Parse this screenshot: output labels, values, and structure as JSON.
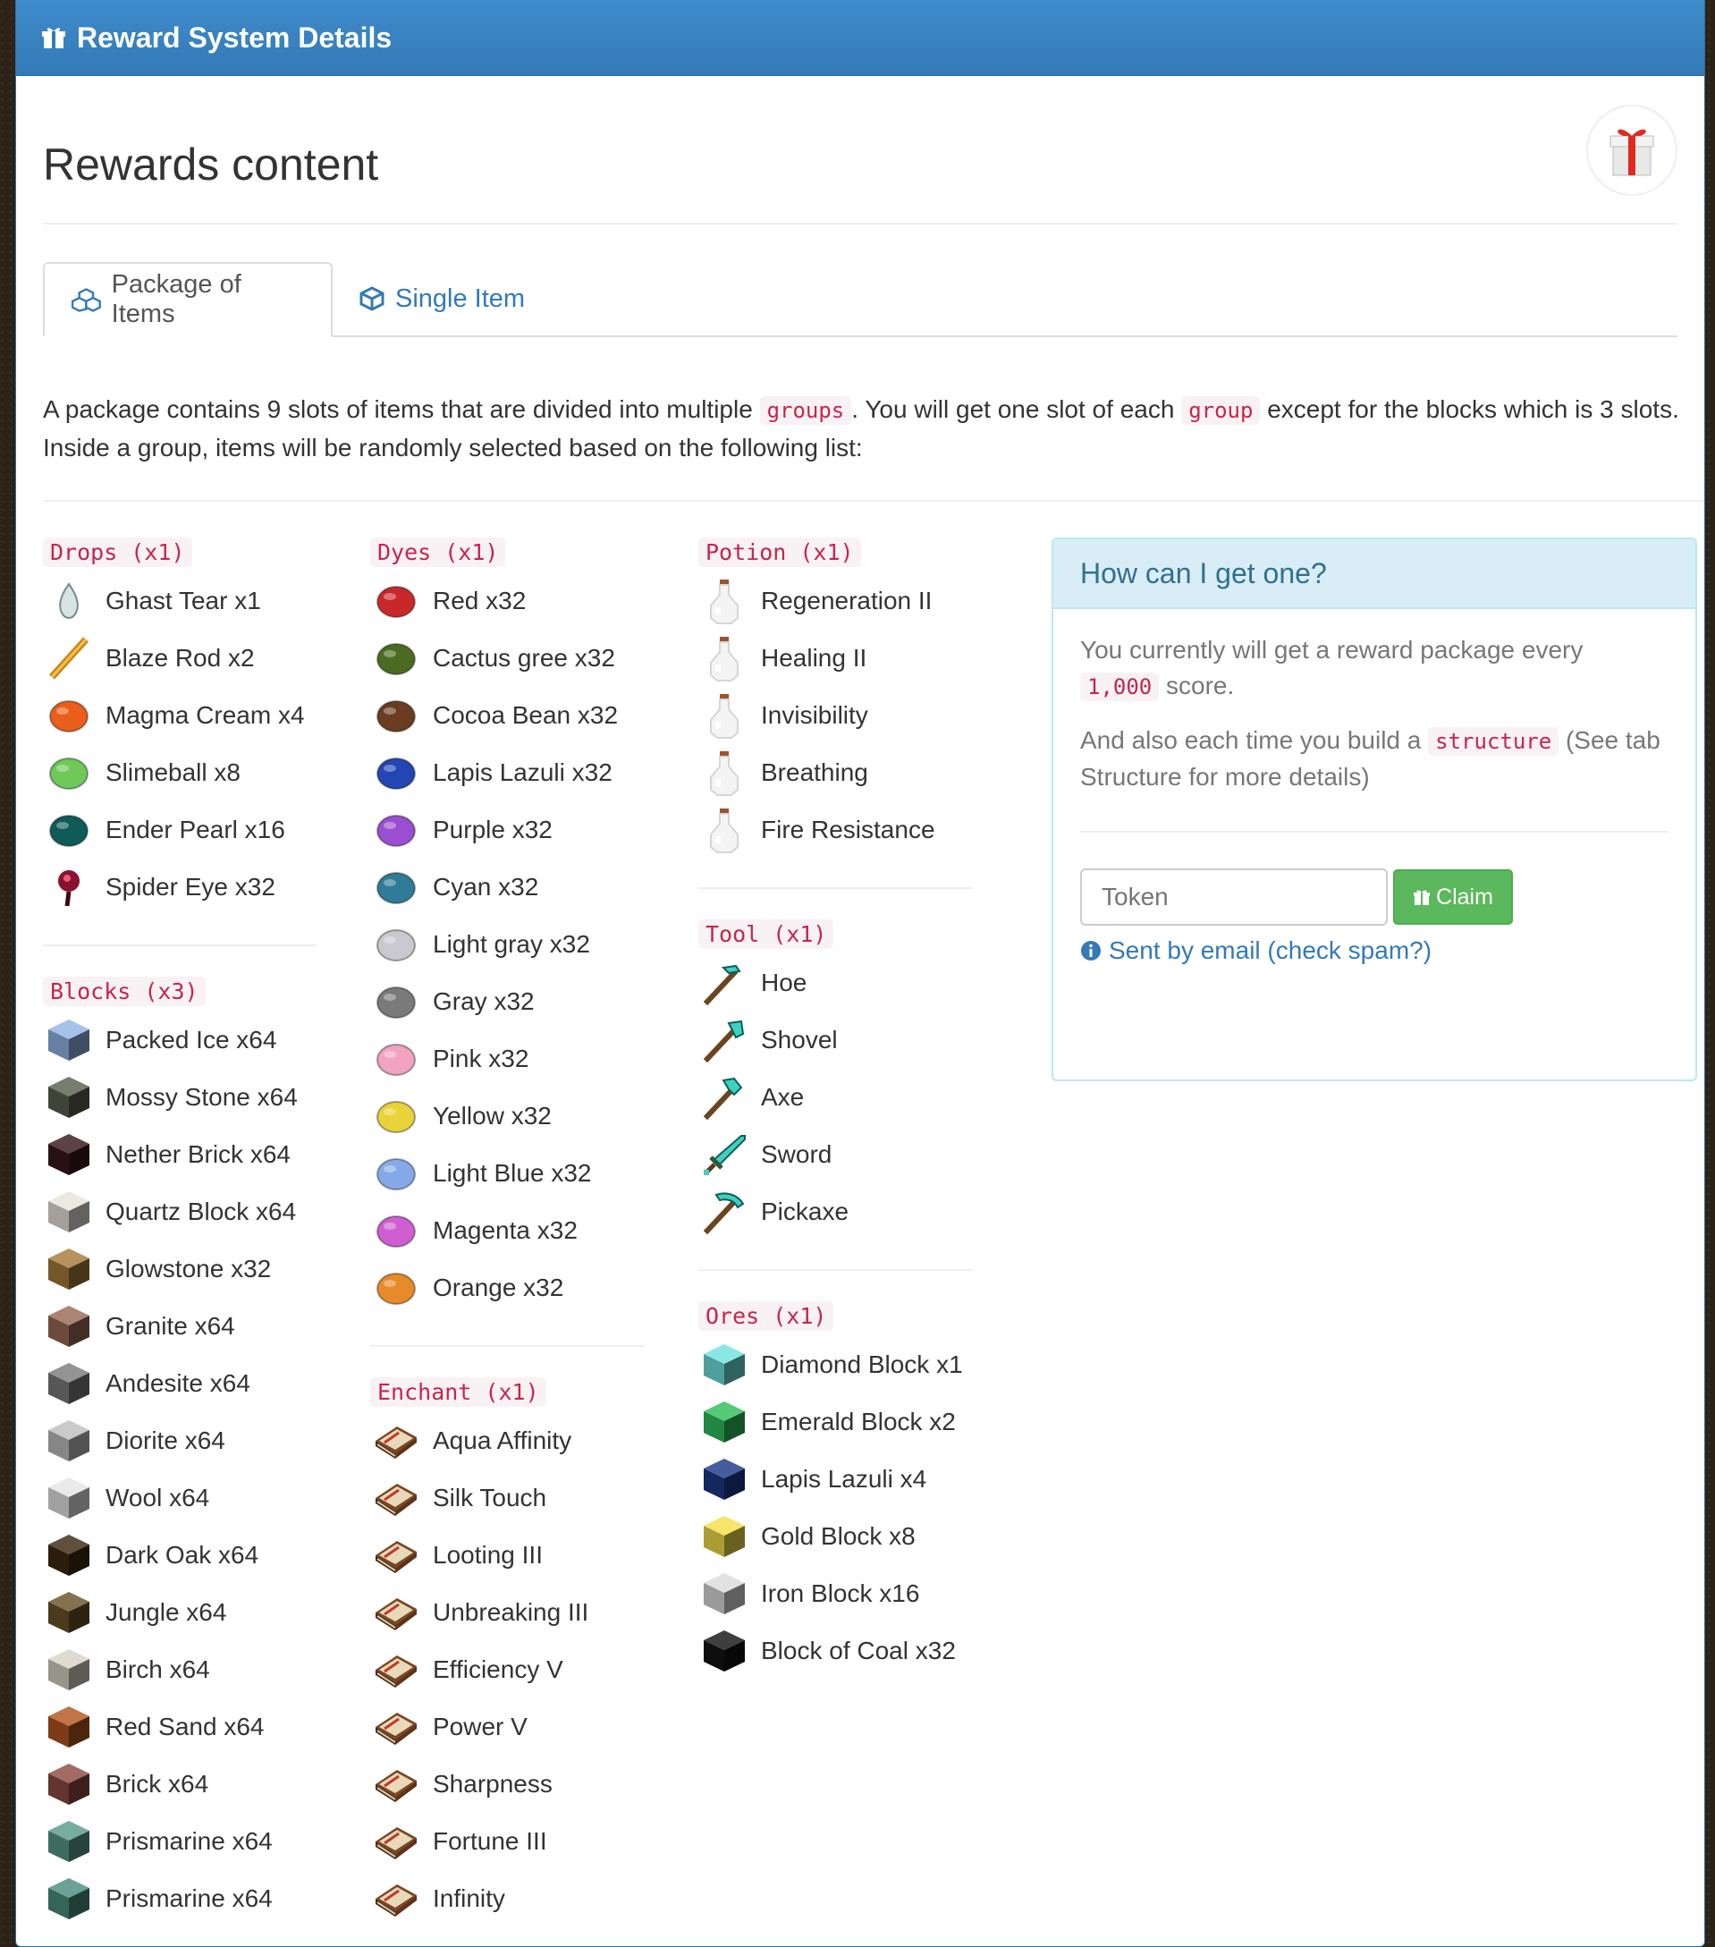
{
  "panel": {
    "title": "Reward System Details"
  },
  "page": {
    "title": "Rewards content"
  },
  "tabs": [
    {
      "label": "Package of Items",
      "active": true,
      "icon": "cubes-icon"
    },
    {
      "label": "Single Item",
      "active": false,
      "icon": "cube-icon"
    }
  ],
  "intro": {
    "part1": "A package contains 9 slots of items that are divided into multiple ",
    "code1": "groups",
    "part2": ". You will get one slot of each ",
    "code2": "group",
    "part3": " except for the blocks which is 3 slots. Inside a group, items will be randomly selected based on the following list:"
  },
  "columns": [
    [
      {
        "label": "Drops (x1)",
        "items": [
          {
            "name": "Ghast Tear x1",
            "icon": "ghast-tear",
            "color": "#d8e4e4"
          },
          {
            "name": "Blaze Rod x2",
            "icon": "blaze-rod",
            "color": "#e9a51c"
          },
          {
            "name": "Magma Cream x4",
            "icon": "magma-cream",
            "color": "#e85e1a"
          },
          {
            "name": "Slimeball x8",
            "icon": "slimeball",
            "color": "#6fc85a"
          },
          {
            "name": "Ender Pearl x16",
            "icon": "ender-pearl",
            "color": "#0f5b57"
          },
          {
            "name": "Spider Eye x32",
            "icon": "spider-eye",
            "color": "#8a1230"
          }
        ]
      },
      {
        "label": "Blocks (x3)",
        "items": [
          {
            "name": "Packed Ice x64",
            "icon": "packed-ice",
            "color": "#93b5e6"
          },
          {
            "name": "Mossy Stone x64",
            "icon": "mossy-stone",
            "color": "#5a6150"
          },
          {
            "name": "Nether Brick x64",
            "icon": "nether-brick",
            "color": "#3a1820"
          },
          {
            "name": "Quartz Block x64",
            "icon": "quartz-block",
            "color": "#e8e4dc"
          },
          {
            "name": "Glowstone x32",
            "icon": "glowstone",
            "color": "#a77a3a"
          },
          {
            "name": "Granite x64",
            "icon": "granite",
            "color": "#9a6a55"
          },
          {
            "name": "Andesite x64",
            "icon": "andesite",
            "color": "#7c7c7c"
          },
          {
            "name": "Diorite x64",
            "icon": "diorite",
            "color": "#bfbfbf"
          },
          {
            "name": "Wool x64",
            "icon": "wool",
            "color": "#e6e6e6"
          },
          {
            "name": "Dark Oak x64",
            "icon": "dark-oak",
            "color": "#3d2912"
          },
          {
            "name": "Jungle x64",
            "icon": "jungle",
            "color": "#6b5228"
          },
          {
            "name": "Birch x64",
            "icon": "birch",
            "color": "#d7d3c6"
          },
          {
            "name": "Red Sand x64",
            "icon": "red-sand",
            "color": "#b3561f"
          },
          {
            "name": "Brick x64",
            "icon": "brick",
            "color": "#8e4b42"
          },
          {
            "name": "Prismarine x64",
            "icon": "prismarine",
            "color": "#5a9b8a"
          },
          {
            "name": "Prismarine x64",
            "icon": "prismarine",
            "color": "#4c8e7e"
          }
        ]
      }
    ],
    [
      {
        "label": "Dyes (x1)",
        "items": [
          {
            "name": "Red x32",
            "icon": "red-dye",
            "color": "#c8282a"
          },
          {
            "name": "Cactus gree x32",
            "icon": "cactus-green-dye",
            "color": "#4b6b21"
          },
          {
            "name": "Cocoa Bean x32",
            "icon": "cocoa-bean",
            "color": "#6a3c22"
          },
          {
            "name": "Lapis Lazuli x32",
            "icon": "lapis-lazuli",
            "color": "#2346b4"
          },
          {
            "name": "Purple x32",
            "icon": "purple-dye",
            "color": "#9a4fd0"
          },
          {
            "name": "Cyan x32",
            "icon": "cyan-dye",
            "color": "#2f7a96"
          },
          {
            "name": "Light gray x32",
            "icon": "light-gray-dye",
            "color": "#c9c9cf"
          },
          {
            "name": "Gray x32",
            "icon": "gray-dye",
            "color": "#7a7a7a"
          },
          {
            "name": "Pink x32",
            "icon": "pink-dye",
            "color": "#f0a4c0"
          },
          {
            "name": "Yellow x32",
            "icon": "yellow-dye",
            "color": "#e9d23a"
          },
          {
            "name": "Light Blue x32",
            "icon": "light-blue-dye",
            "color": "#86aae8"
          },
          {
            "name": "Magenta x32",
            "icon": "magenta-dye",
            "color": "#cf5fd0"
          },
          {
            "name": "Orange x32",
            "icon": "orange-dye",
            "color": "#e68a2a"
          }
        ]
      },
      {
        "label": "Enchant (x1)",
        "items": [
          {
            "name": "Aqua Affinity",
            "icon": "enchanted-book",
            "color": "#6b3a1f"
          },
          {
            "name": "Silk Touch",
            "icon": "enchanted-book",
            "color": "#6b3a1f"
          },
          {
            "name": "Looting III",
            "icon": "enchanted-book",
            "color": "#6b3a1f"
          },
          {
            "name": "Unbreaking III",
            "icon": "enchanted-book",
            "color": "#6b3a1f"
          },
          {
            "name": "Efficiency V",
            "icon": "enchanted-book",
            "color": "#6b3a1f"
          },
          {
            "name": "Power V",
            "icon": "enchanted-book",
            "color": "#6b3a1f"
          },
          {
            "name": "Sharpness",
            "icon": "enchanted-book",
            "color": "#6b3a1f"
          },
          {
            "name": "Fortune III",
            "icon": "enchanted-book",
            "color": "#6b3a1f"
          },
          {
            "name": "Infinity",
            "icon": "enchanted-book",
            "color": "#6b3a1f"
          }
        ]
      }
    ],
    [
      {
        "label": "Potion (x1)",
        "items": [
          {
            "name": "Regeneration II",
            "icon": "potion-bottle",
            "color": "#e8e8e8"
          },
          {
            "name": "Healing II",
            "icon": "potion-bottle",
            "color": "#e8e8e8"
          },
          {
            "name": "Invisibility",
            "icon": "potion-bottle",
            "color": "#e8e8e8"
          },
          {
            "name": "Breathing",
            "icon": "potion-bottle",
            "color": "#e8e8e8"
          },
          {
            "name": "Fire Resistance",
            "icon": "potion-bottle",
            "color": "#e8e8e8"
          }
        ]
      },
      {
        "label": "Tool (x1)",
        "items": [
          {
            "name": "Hoe",
            "icon": "diamond-hoe",
            "color": "#3fd0c0"
          },
          {
            "name": "Shovel",
            "icon": "diamond-shovel",
            "color": "#3fd0c0"
          },
          {
            "name": "Axe",
            "icon": "diamond-axe",
            "color": "#3fd0c0"
          },
          {
            "name": "Sword",
            "icon": "diamond-sword",
            "color": "#3fd0c0"
          },
          {
            "name": "Pickaxe",
            "icon": "diamond-pickaxe",
            "color": "#3fd0c0"
          }
        ]
      },
      {
        "label": "Ores (x1)",
        "items": [
          {
            "name": "Diamond Block x1",
            "icon": "diamond-block",
            "color": "#6fe3de"
          },
          {
            "name": "Emerald Block x2",
            "icon": "emerald-block",
            "color": "#2fbf5a"
          },
          {
            "name": "Lapis Lazuli x4",
            "icon": "lapis-block",
            "color": "#1d3a8a"
          },
          {
            "name": "Gold Block x8",
            "icon": "gold-block",
            "color": "#f4e04a"
          },
          {
            "name": "Iron Block x16",
            "icon": "iron-block",
            "color": "#dcdcdc"
          },
          {
            "name": "Block of Coal x32",
            "icon": "coal-block",
            "color": "#141414"
          }
        ]
      }
    ]
  ],
  "howto": {
    "title": "How can I get one?",
    "line1_part1": "You currently will get a reward package every ",
    "line1_code": "1,000",
    "line1_part2": " score.",
    "line2_part1": "And also each time you build a ",
    "line2_code": "structure",
    "line2_part2": " (See tab Structure for more details)",
    "token_placeholder": "Token",
    "claim_label": "Claim",
    "sent_link": "Sent by email (check spam?)"
  }
}
